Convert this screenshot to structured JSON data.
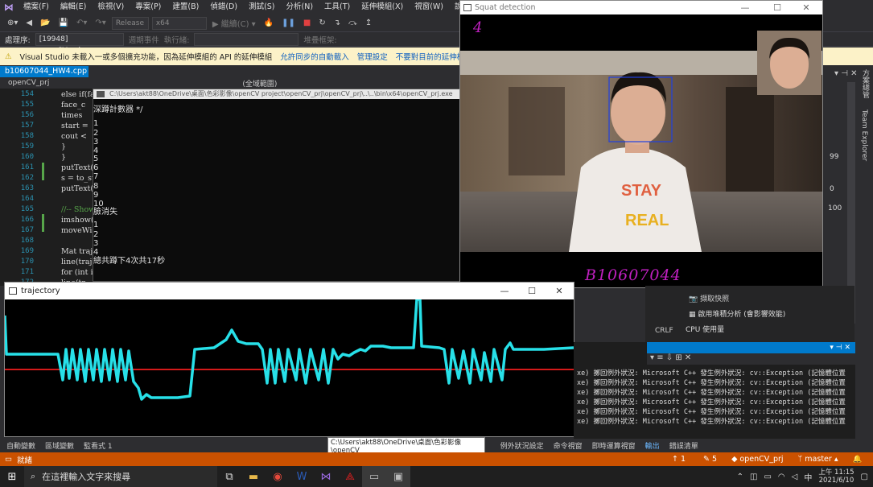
{
  "menubar": {
    "items": [
      "檔案(F)",
      "編輯(E)",
      "檢視(V)",
      "專案(P)",
      "建置(B)",
      "偵錯(D)",
      "測試(S)",
      "分析(N)",
      "工具(T)",
      "延伸模組(X)",
      "視窗(W)",
      "說明(H)",
      "搜尋"
    ],
    "share_label": "hare"
  },
  "toolbar": {
    "config": "Release",
    "platform": "x64",
    "continue": "繼續(C)"
  },
  "procbar": {
    "label": "處理序:",
    "process": "[19948] openCV_prj.exe",
    "lifecycle": "週期事件",
    "thread": "執行緒:",
    "stack": "堆疊框架:"
  },
  "infobar": {
    "message": "Visual Studio 未載入一或多個擴充功能，因為延伸模組的 API 的延伸模組",
    "link1": "允許同步的自動載入",
    "link2": "管理設定",
    "link3": "不要對目前的延伸模組顯示此訊息"
  },
  "doc_tab": "b10607044_HW4.cpp",
  "nav": {
    "project": "openCV_prj",
    "scope": "(全域範圍)"
  },
  "editor": {
    "lines": [
      {
        "n": "154",
        "code": "else if(fa"
      },
      {
        "n": "155",
        "code": "face_c"
      },
      {
        "n": "156",
        "code": "times"
      },
      {
        "n": "157",
        "code": "start ="
      },
      {
        "n": "158",
        "code": "cout <"
      },
      {
        "n": "159",
        "code": "}"
      },
      {
        "n": "160",
        "code": "}"
      },
      {
        "n": "161",
        "code": "putText("
      },
      {
        "n": "162",
        "code": "s = to_st"
      },
      {
        "n": "163",
        "code": "putText("
      },
      {
        "n": "164",
        "code": ""
      },
      {
        "n": "165",
        "code": "//-- Show"
      },
      {
        "n": "166",
        "code": "imshow("
      },
      {
        "n": "167",
        "code": "moveWi"
      },
      {
        "n": "168",
        "code": ""
      },
      {
        "n": "169",
        "code": "Mat traj"
      },
      {
        "n": "170",
        "code": "line(traje"
      },
      {
        "n": "171",
        "code": "for (int i"
      },
      {
        "n": "172",
        "code": "line(tr"
      }
    ]
  },
  "console": {
    "title": "C:\\Users\\akt88\\OneDrive\\桌面\\色彩影像\\openCV project\\openCV_prj\\openCV_prj\\..\\..\\bin\\x64\\openCV_prj.exe",
    "lines": [
      "深蹲計數器 */",
      "1",
      "2",
      "3",
      "4",
      "5",
      "6",
      "7",
      "8",
      "9",
      "10",
      "臉消失",
      "1",
      "2",
      "3",
      "4",
      "總共蹲下4次共17秒"
    ]
  },
  "squat": {
    "title": "Squat detection",
    "count": "4",
    "student_id": "B10607044"
  },
  "trajectory": {
    "title": "trajectory"
  },
  "rightpane": {
    "vertical_labels": [
      "方案總管",
      "Team Explorer"
    ],
    "numbers": [
      "99",
      "0",
      "100"
    ],
    "snapshot": "擷取快照",
    "heap": "啟用堆積分析 (會影響效能)",
    "cpu": "CPU 使用量",
    "crlf": "CRLF"
  },
  "output": {
    "lines": [
      "xe) 擲回例外狀況: Microsoft C++ 發生例外狀況: cv::Exception (記憶體位置",
      "xe) 擲回例外狀況: Microsoft C++ 發生例外狀況: cv::Exception (記憶體位置",
      "xe) 擲回例外狀況: Microsoft C++ 發生例外狀況: cv::Exception (記憶體位置",
      "xe) 擲回例外狀況: Microsoft C++ 發生例外狀況: cv::Exception (記憶體位置",
      "xe) 擲回例外狀況: Microsoft C++ 發生例外狀況: cv::Exception (記憶體位置",
      "xe) 擲回例外狀況: Microsoft C++ 發生例外狀況: cv::Exception (記憶體位置"
    ]
  },
  "bottom_tabs": [
    "自動變數",
    "區域變數",
    "監看式 1",
    "例外狀況設定",
    "命令視窗",
    "即時運算視窗",
    "輸出",
    "錯誤清單"
  ],
  "tooltip": "C:\\Users\\akt88\\OneDrive\\桌面\\色彩影像\\openCV project\\openCV_prj\\openCV_prj\\..\\..\\bin\\x64\\openCV_prj.exe",
  "statusbar": {
    "ready": "就緒",
    "up": "1",
    "pencil": "5",
    "project": "openCV_prj",
    "branch": "master"
  },
  "taskbar": {
    "search_placeholder": "在這裡輸入文字來搜尋",
    "time": "上午 11:15",
    "date": "2021/6/10",
    "ime": "中"
  },
  "colors": {
    "accent": "#007acc",
    "status": "#ca5100",
    "overlay_text": "#c020c0",
    "trajectory": "#27e0e8",
    "baseline": "#d41a1a"
  }
}
